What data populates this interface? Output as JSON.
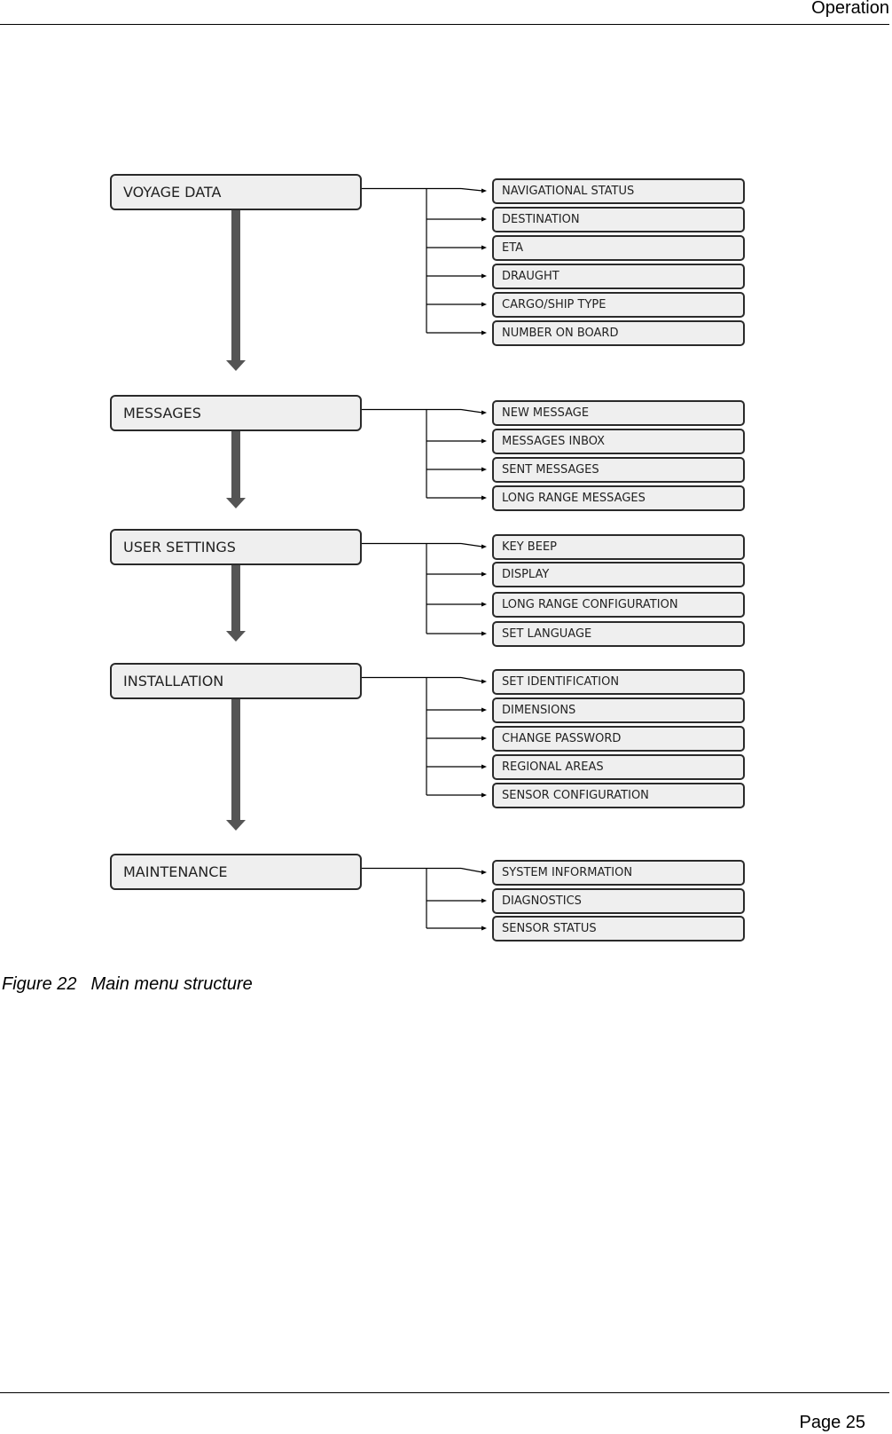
{
  "header": {
    "section_title": "Operation"
  },
  "figure": {
    "number_label": "Figure 22",
    "caption": "Main menu structure",
    "menus": [
      {
        "label": "VOYAGE DATA",
        "items": [
          "NAVIGATIONAL STATUS",
          "DESTINATION",
          "ETA",
          "DRAUGHT",
          "CARGO/SHIP TYPE",
          "NUMBER ON BOARD"
        ]
      },
      {
        "label": "MESSAGES",
        "items": [
          "NEW MESSAGE",
          "MESSAGES INBOX",
          "SENT MESSAGES",
          "LONG RANGE MESSAGES"
        ]
      },
      {
        "label": "USER SETTINGS",
        "items": [
          "KEY BEEP",
          "DISPLAY",
          "LONG RANGE CONFIGURATION",
          "SET LANGUAGE"
        ]
      },
      {
        "label": "INSTALLATION",
        "items": [
          "SET IDENTIFICATION",
          "DIMENSIONS",
          "CHANGE PASSWORD",
          "REGIONAL AREAS",
          "SENSOR CONFIGURATION"
        ]
      },
      {
        "label": "MAINTENANCE",
        "items": [
          "SYSTEM INFORMATION",
          "DIAGNOSTICS",
          "SENSOR STATUS"
        ]
      }
    ]
  },
  "footer": {
    "page_label": "Page 25"
  },
  "colors": {
    "box_fill": "#efefef",
    "box_border": "#2a2a2a",
    "flow_arrow": "#555555",
    "connector": "#000000"
  }
}
